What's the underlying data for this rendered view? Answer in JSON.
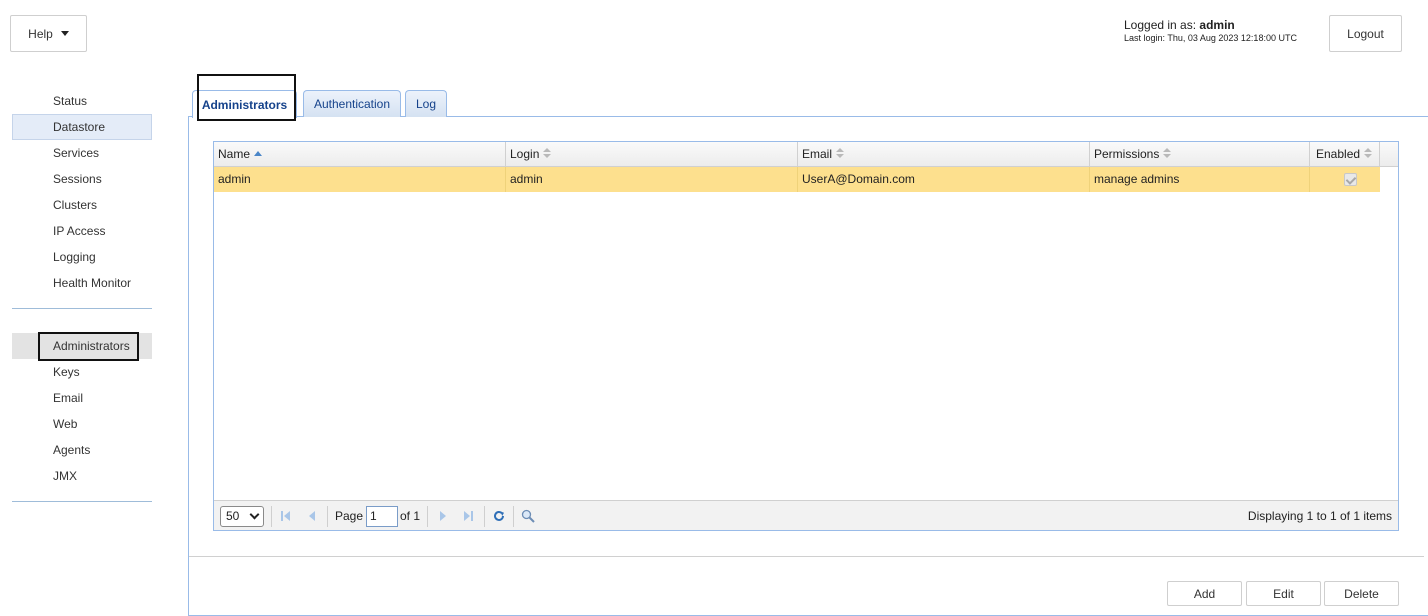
{
  "header": {
    "help_label": "Help",
    "logged_in_prefix": "Logged in as: ",
    "username": "admin",
    "last_login": "Last login: Thu, 03 Aug 2023 12:18:00 UTC",
    "logout_label": "Logout"
  },
  "sidebar": {
    "group1": [
      "Status",
      "Datastore",
      "Services",
      "Sessions",
      "Clusters",
      "IP Access",
      "Logging",
      "Health Monitor"
    ],
    "group2": [
      "Administrators",
      "Keys",
      "Email",
      "Web",
      "Agents",
      "JMX"
    ]
  },
  "tabs": [
    "Administrators",
    "Authentication",
    "Log"
  ],
  "grid": {
    "columns": [
      "Name",
      "Login",
      "Email",
      "Permissions",
      "Enabled"
    ],
    "rows": [
      {
        "name": "admin",
        "login": "admin",
        "email": "UserA@Domain.com",
        "permissions": "manage admins",
        "enabled": true
      }
    ]
  },
  "pager": {
    "page_size": "50",
    "page_label": "Page",
    "page_value": "1",
    "of_label": "of 1",
    "displaying": "Displaying 1 to 1 of 1 items"
  },
  "actions": {
    "add": "Add",
    "edit": "Edit",
    "delete": "Delete"
  },
  "colors": {
    "selected_row": "#fde08e",
    "tab_text": "#15428b",
    "border_blue": "#99bbe8"
  }
}
